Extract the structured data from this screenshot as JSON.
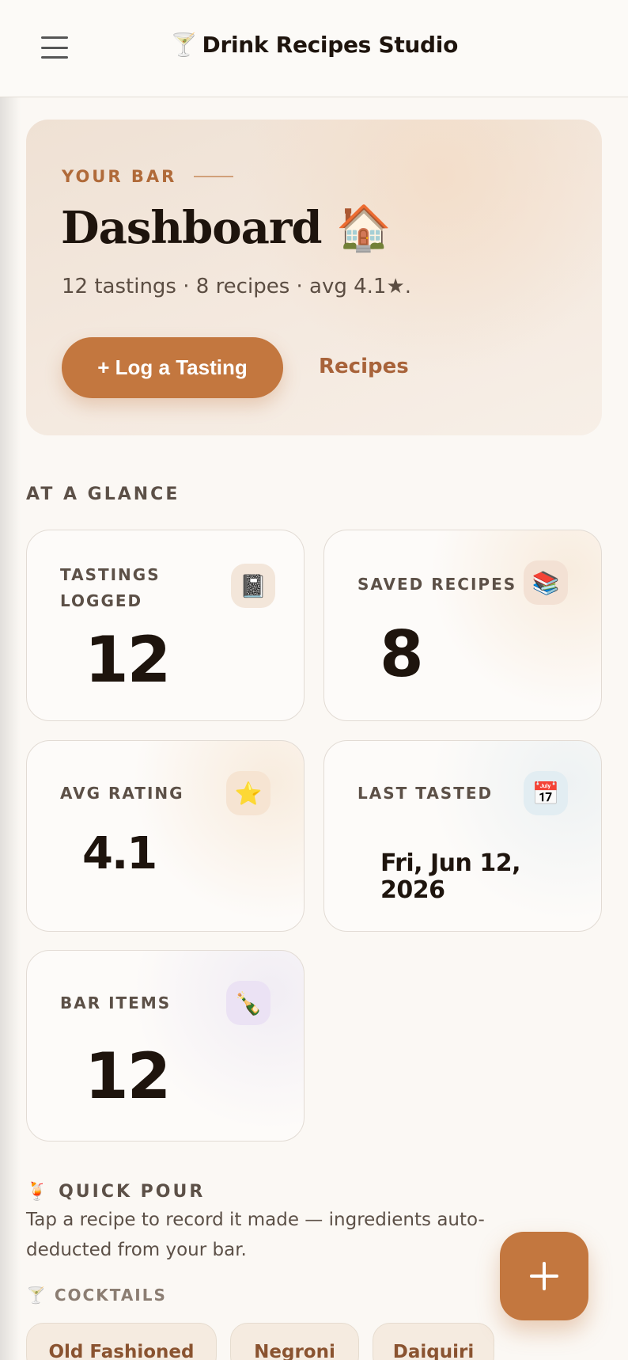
{
  "header": {
    "title": "Drink Recipes Studio",
    "title_glyph": "🍸",
    "menu_icon": "hamburger-menu-icon"
  },
  "hero": {
    "eyebrow": "YOUR BAR",
    "title": "Dashboard 🏠",
    "subtitle": "12 tastings · 8 recipes · avg 4.1★.",
    "primary_button": "+ Log a Tasting",
    "secondary_link": "Recipes"
  },
  "glance": {
    "label": "AT A GLANCE",
    "stats": [
      {
        "label": "TASTINGS LOGGED",
        "value": "12",
        "icon": "📓",
        "icon_name": "notebook-icon"
      },
      {
        "label": "SAVED RECIPES",
        "value": "8",
        "icon": "📚",
        "icon_name": "books-icon"
      },
      {
        "label": "AVG RATING",
        "value": "4.1",
        "icon": "⭐",
        "icon_name": "star-icon"
      },
      {
        "label": "LAST TASTED",
        "value": "Fri, Jun 12, 2026",
        "icon": "📅",
        "icon_name": "calendar-icon"
      },
      {
        "label": "BAR ITEMS",
        "value": "12",
        "icon": "🍾",
        "icon_name": "bottle-icon"
      }
    ]
  },
  "quick_pour": {
    "glyph": "🍹",
    "label": "QUICK POUR",
    "description": "Tap a recipe to record it made — ingredients auto-deducted from your bar.",
    "category_glyph": "🍸",
    "category": "COCKTAILS",
    "recipes": [
      "Old Fashioned",
      "Negroni",
      "Daiquiri"
    ]
  },
  "fab": {
    "icon": "plus-icon"
  },
  "colors": {
    "accent": "#c3773f",
    "accent_text": "#b06a39",
    "background": "#fbf8f4",
    "text": "#1e140d"
  }
}
